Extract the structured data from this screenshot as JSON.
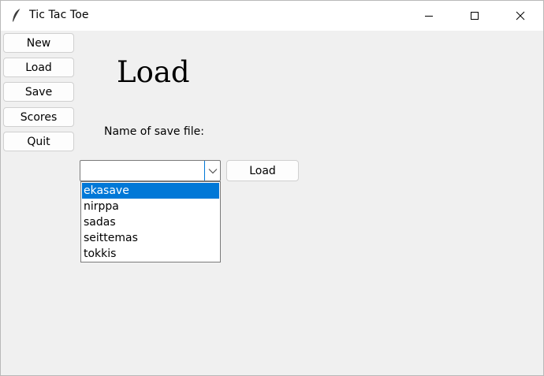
{
  "window": {
    "title": "Tic Tac Toe",
    "icon": "feather-icon"
  },
  "sidebar": {
    "buttons": [
      {
        "label": "New"
      },
      {
        "label": "Load"
      },
      {
        "label": "Save"
      },
      {
        "label": "Scores"
      },
      {
        "label": "Quit"
      }
    ]
  },
  "main": {
    "heading": "Load",
    "field_label": "Name of save file:",
    "combo_value": "",
    "load_button_label": "Load",
    "save_files": [
      {
        "name": "ekasave",
        "selected": true
      },
      {
        "name": "nirppa",
        "selected": false
      },
      {
        "name": "sadas",
        "selected": false
      },
      {
        "name": "seittemas",
        "selected": false
      },
      {
        "name": "tokkis",
        "selected": false
      }
    ]
  },
  "colors": {
    "selection": "#0078d7",
    "window_bg": "#f0f0f0"
  }
}
